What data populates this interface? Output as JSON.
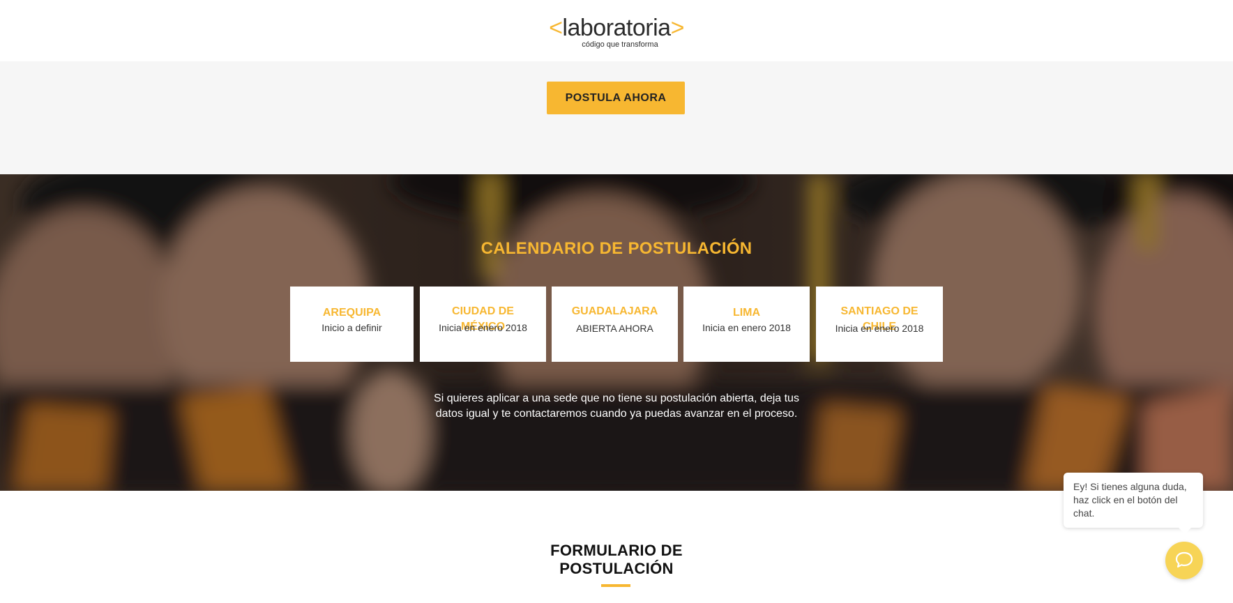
{
  "header": {
    "logo_open": "<",
    "logo_word": "laboratoria",
    "logo_close": ">",
    "logo_tagline": "código que transforma"
  },
  "cta": {
    "button_label": "POSTULA AHORA"
  },
  "calendar": {
    "title": "CALENDARIO DE POSTULACIÓN",
    "cards": [
      {
        "city": "AREQUIPA",
        "status": "Inicio a definir"
      },
      {
        "city": "CIUDAD DE MÉXICO",
        "status": "Inicia en enero 2018"
      },
      {
        "city": "GUADALAJARA",
        "status": "ABIERTA AHORA"
      },
      {
        "city": "LIMA",
        "status": "Inicia en enero 2018"
      },
      {
        "city": "SANTIAGO DE CHILE",
        "status": "Inicia en enero 2018"
      }
    ],
    "note": "Si quieres aplicar a una sede que no tiene su postulación abierta, deja tus datos igual y te contactaremos cuando  ya puedas avanzar en el proceso."
  },
  "form": {
    "title_line1": "FORMULARIO DE",
    "title_line2": "POSTULACIÓN"
  },
  "chat": {
    "bubble_text": "Ey! Si tienes alguna duda, haz click en el botón del chat.",
    "button_icon": "chat-icon"
  },
  "colors": {
    "accent": "#f7b731",
    "chat_button": "#f7d456",
    "cta_background": "#f6f6f6"
  }
}
